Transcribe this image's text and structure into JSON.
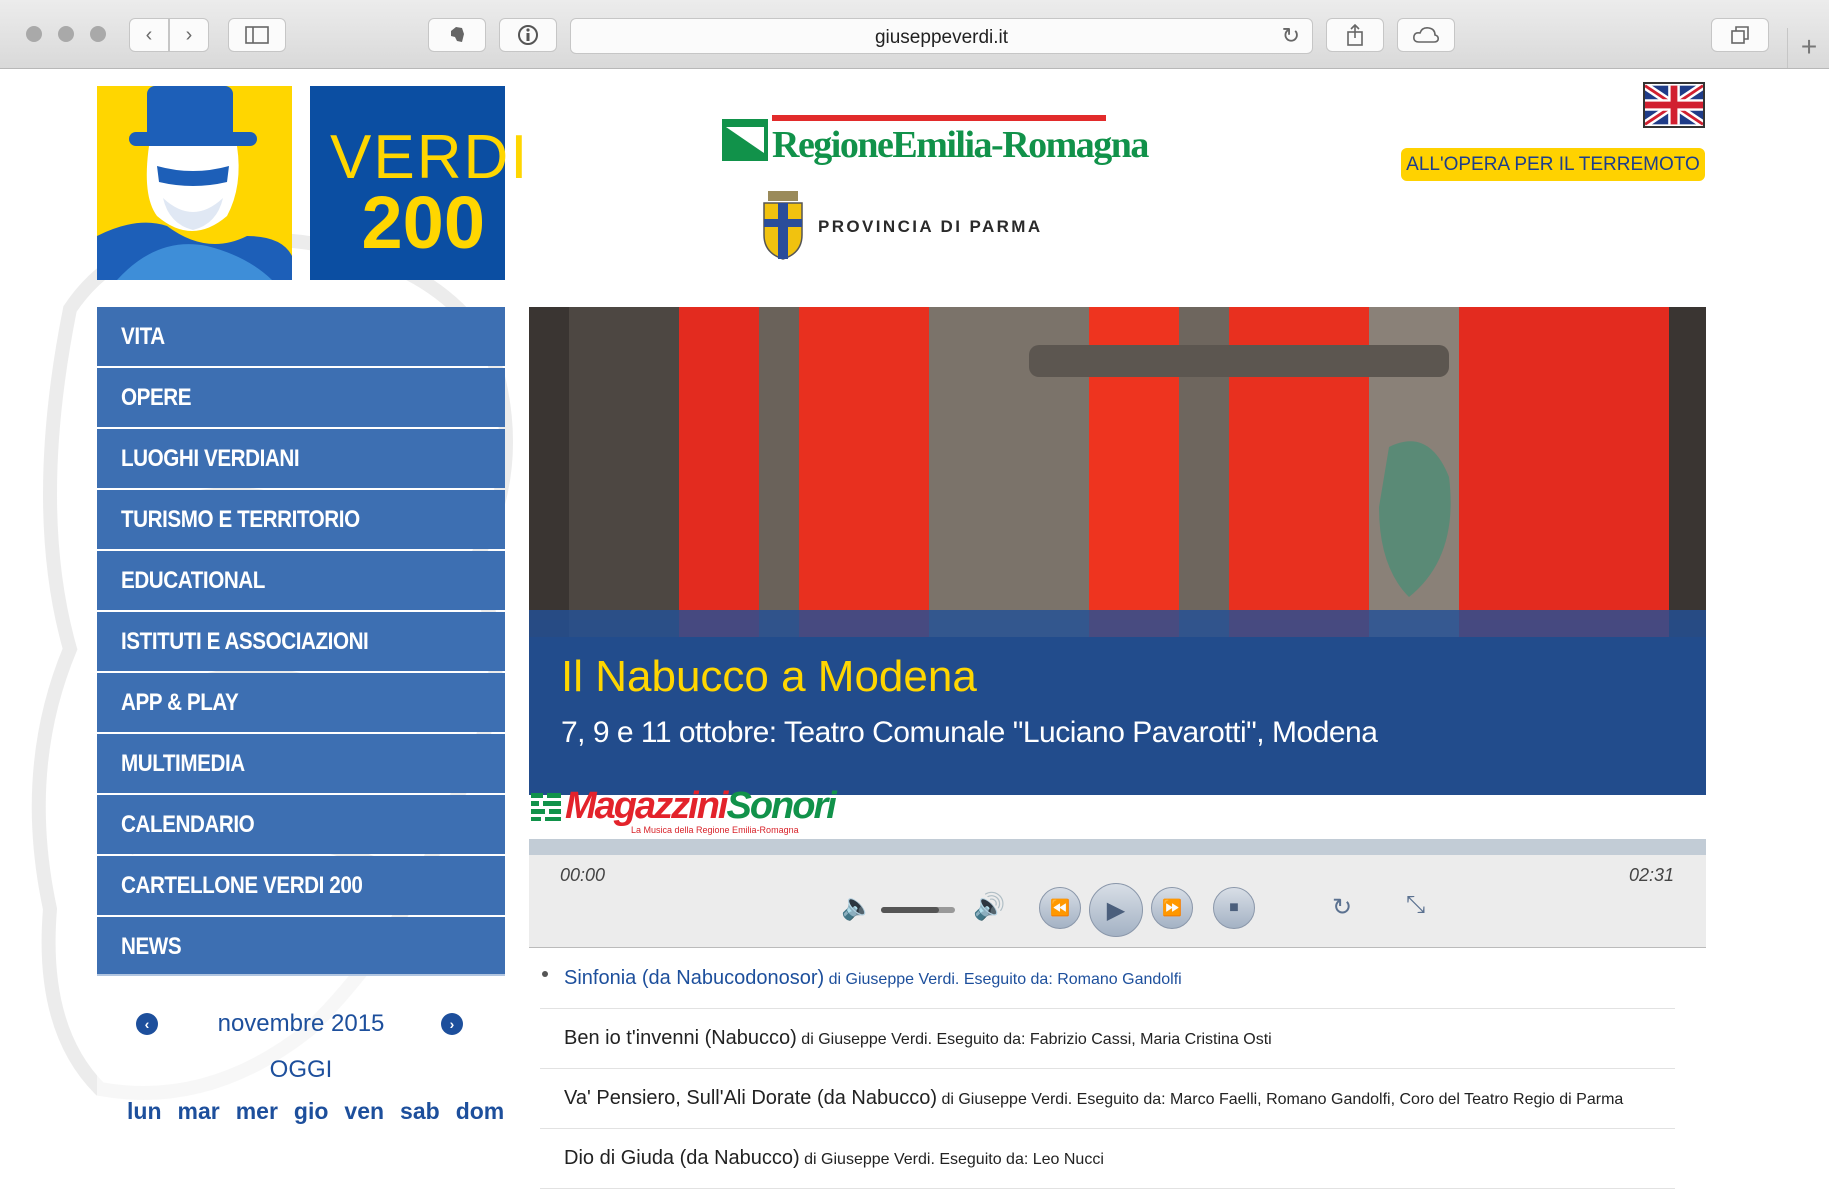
{
  "browser": {
    "url": "giuseppeverdi.it",
    "back_icon": "chevron-left-icon",
    "forward_icon": "chevron-right-icon"
  },
  "header": {
    "logo_verdi": "VERDI",
    "logo_number": "200",
    "region_name": "RegioneEmilia-Romagna",
    "province_name": "PROVINCIA DI PARMA",
    "earthquake_button": "ALL'OPERA PER IL TERREMOTO"
  },
  "menu": {
    "items": [
      {
        "label": "VITA"
      },
      {
        "label": "OPERE"
      },
      {
        "label": "LUOGHI VERDIANI"
      },
      {
        "label": "TURISMO E TERRITORIO"
      },
      {
        "label": "EDUCATIONAL"
      },
      {
        "label": "ISTITUTI E ASSOCIAZIONI"
      },
      {
        "label": "APP & PLAY"
      },
      {
        "label": "MULTIMEDIA"
      },
      {
        "label": "CALENDARIO"
      },
      {
        "label": "CARTELLONE VERDI 200"
      },
      {
        "label": "NEWS"
      }
    ]
  },
  "calendar": {
    "month": "novembre 2015",
    "today": "OGGI",
    "days": [
      "lun",
      "mar",
      "mer",
      "gio",
      "ven",
      "sab",
      "dom"
    ]
  },
  "hero": {
    "title": "Il Nabucco a Modena",
    "subtitle": "7, 9 e 11 ottobre: Teatro Comunale \"Luciano Pavarotti\", Modena"
  },
  "magazzini": {
    "name_part1": "Magazzini",
    "name_part2": "Sonori",
    "tagline": "La Musica della Regione Emilia-Romagna"
  },
  "player": {
    "current_time": "00:00",
    "duration": "02:31",
    "volume_level": 0.78
  },
  "playlist": [
    {
      "title": "Sinfonia (da Nabucodonosor)",
      "meta": "di Giuseppe Verdi. Eseguito da: Romano Gandolfi",
      "active": true
    },
    {
      "title": "Ben io t'invenni (Nabucco)",
      "meta": "di Giuseppe Verdi. Eseguito da: Fabrizio Cassi, Maria Cristina Osti",
      "active": false
    },
    {
      "title": "Va' Pensiero, Sull'Ali Dorate (da Nabucco)",
      "meta": "di Giuseppe Verdi. Eseguito da: Marco Faelli, Romano Gandolfi, Coro del Teatro Regio di Parma",
      "active": false
    },
    {
      "title": "Dio di Giuda (da Nabucco)",
      "meta": "di Giuseppe Verdi. Eseguito da: Leo Nucci",
      "active": false
    }
  ],
  "colors": {
    "menu_blue": "#3d6fb2",
    "accent_yellow": "#ffd600",
    "link_blue": "#1d4f9c"
  }
}
